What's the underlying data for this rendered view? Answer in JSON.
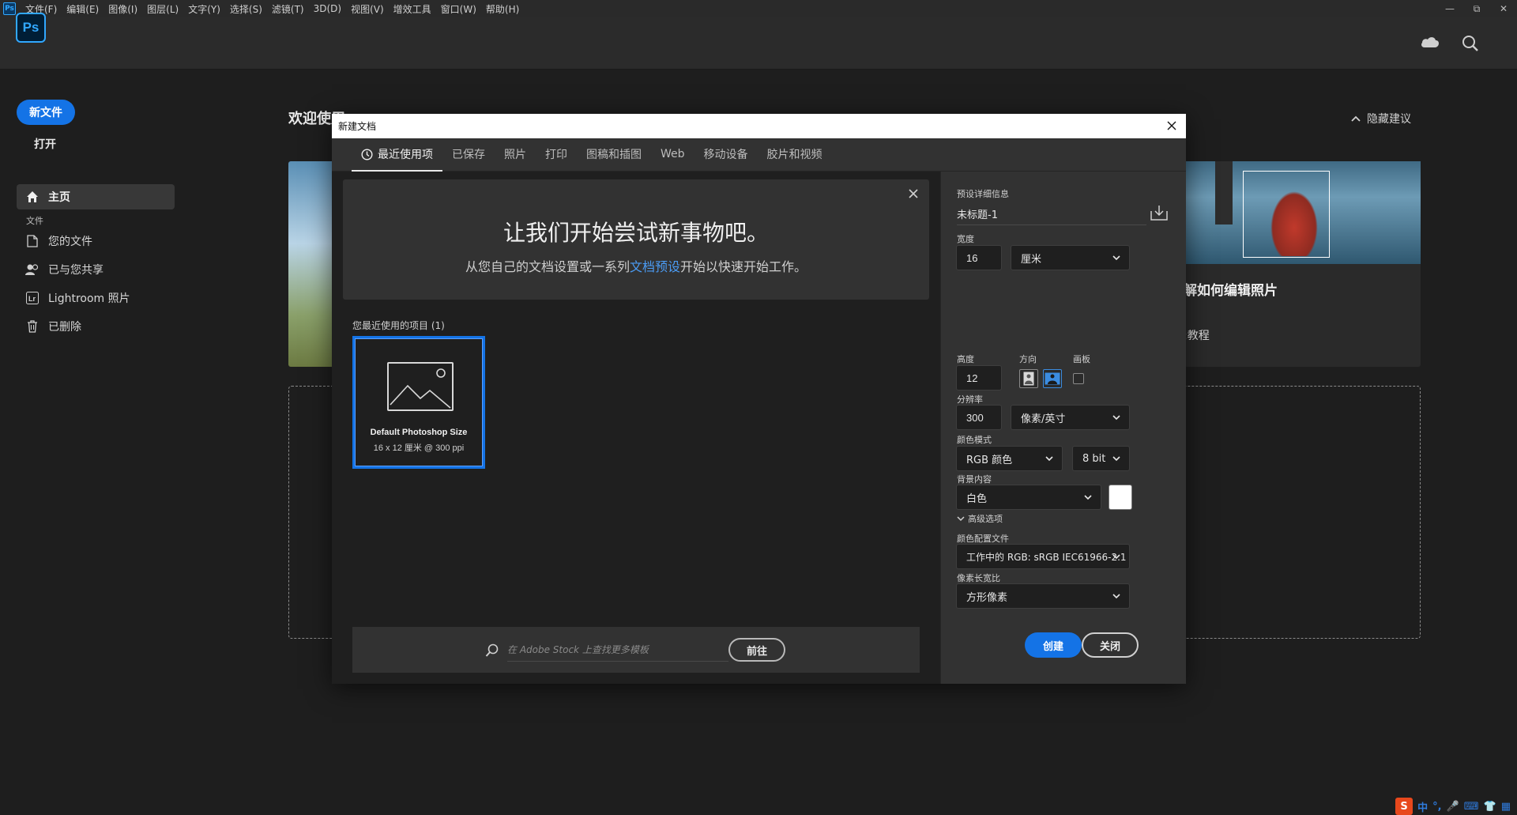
{
  "menubar": {
    "app_icon": "Ps",
    "items": [
      "文件(F)",
      "编辑(E)",
      "图像(I)",
      "图层(L)",
      "文字(Y)",
      "选择(S)",
      "滤镜(T)",
      "3D(D)",
      "视图(V)",
      "增效工具",
      "窗口(W)",
      "帮助(H)"
    ]
  },
  "topbar": {
    "logo": "Ps",
    "icons": [
      "cloud-icon",
      "search-icon"
    ]
  },
  "sidebar": {
    "new_file": "新文件",
    "open": "打开",
    "home": "主页",
    "section_files": "文件",
    "items": [
      {
        "label": "您的文件",
        "icon": "document-icon"
      },
      {
        "label": "已与您共享",
        "icon": "shared-users-icon"
      },
      {
        "label": "Lightroom 照片",
        "icon": "lightroom-icon"
      },
      {
        "label": "已删除",
        "icon": "trash-icon"
      }
    ]
  },
  "home": {
    "welcome": "欢迎使用",
    "hide_suggestions": "隐藏建议",
    "learn_title": "解如何编辑照片",
    "learn_sub": ":教程"
  },
  "dialog": {
    "title": "新建文档",
    "tabs": [
      "最近使用项",
      "已保存",
      "照片",
      "打印",
      "图稿和插图",
      "Web",
      "移动设备",
      "胶片和视频"
    ],
    "active_tab": "最近使用项",
    "promo_heading": "让我们开始尝试新事物吧。",
    "promo_text_before": "从您自己的文档设置或一系列",
    "promo_link": "文档预设",
    "promo_text_after": "开始以快速开始工作。",
    "recent_label": "您最近使用的项目 (1)",
    "preset": {
      "name": "Default Photoshop Size",
      "size": "16 x 12 厘米 @ 300 ppi"
    },
    "stock_placeholder": "在 Adobe Stock 上查找更多模板",
    "go_label": "前往",
    "details": {
      "heading": "预设详细信息",
      "doc_name": "未标题-1",
      "width_label": "宽度",
      "width": "16",
      "width_unit": "厘米",
      "height_label": "高度",
      "height": "12",
      "orientation_label": "方向",
      "artboard_label": "画板",
      "resolution_label": "分辨率",
      "resolution": "300",
      "resolution_unit": "像素/英寸",
      "color_mode_label": "颜色模式",
      "color_mode": "RGB 颜色",
      "bit_depth": "8 bit",
      "bg_label": "背景内容",
      "bg": "白色",
      "bg_color": "#ffffff",
      "advanced_label": "高级选项",
      "profile_label": "颜色配置文件",
      "profile": "工作中的 RGB: sRGB IEC61966-2.1",
      "pixel_ratio_label": "像素长宽比",
      "pixel_ratio": "方形像素",
      "create": "创建",
      "close": "关闭"
    }
  },
  "ime": {
    "logo": "S",
    "lang": "中"
  },
  "colors": {
    "accent": "#1473e6",
    "link": "#4b9cf5"
  }
}
